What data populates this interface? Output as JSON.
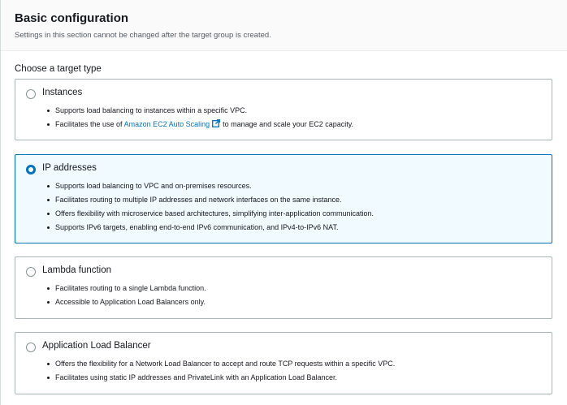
{
  "header": {
    "title": "Basic configuration",
    "description": "Settings in this section cannot be changed after the target group is created."
  },
  "target_type": {
    "label": "Choose a target type",
    "selected": "IP addresses",
    "options": [
      {
        "title": "Instances",
        "bullets": [
          "Supports load balancing to instances within a specific VPC.",
          {
            "prefix": "Facilitates the use of",
            "link": "Amazon EC2 Auto Scaling",
            "suffix": "to manage and scale your EC2 capacity."
          }
        ]
      },
      {
        "title": "IP addresses",
        "bullets": [
          "Supports load balancing to VPC and on-premises resources.",
          "Facilitates routing to multiple IP addresses and network interfaces on the same instance.",
          "Offers flexibility with microservice based architectures, simplifying inter-application communication.",
          "Supports IPv6 targets, enabling end-to-end IPv6 communication, and IPv4-to-IPv6 NAT."
        ]
      },
      {
        "title": "Lambda function",
        "bullets": [
          "Facilitates routing to a single Lambda function.",
          "Accessible to Application Load Balancers only."
        ]
      },
      {
        "title": "Application Load Balancer",
        "bullets": [
          "Offers the flexibility for a Network Load Balancer to accept and route TCP requests within a specific VPC.",
          "Facilitates using static IP addresses and PrivateLink with an Application Load Balancer."
        ]
      }
    ]
  },
  "colors": {
    "accent": "#0073bb",
    "selected_bg": "#f1faff",
    "border": "#aab7b8"
  },
  "icons": {
    "external_link": "external-link-icon"
  }
}
